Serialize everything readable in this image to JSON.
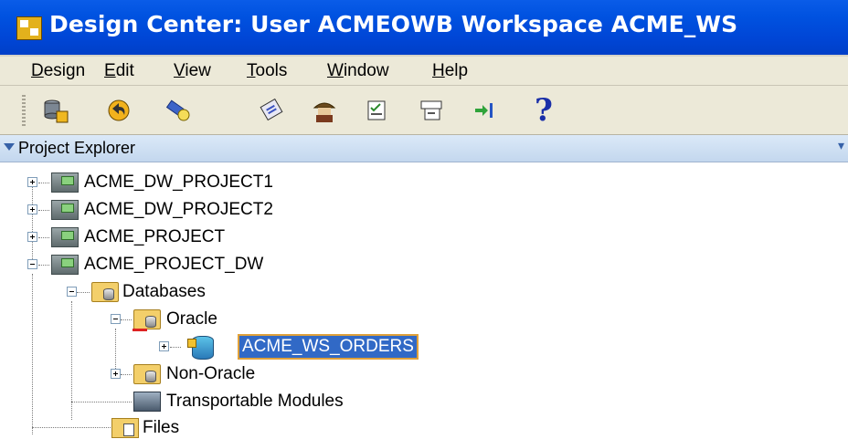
{
  "window": {
    "title": "Design Center: User ACMEOWB   Workspace ACME_WS"
  },
  "menu": [
    {
      "label": "Design",
      "mnemonic": "D"
    },
    {
      "label": "Edit",
      "mnemonic": "E"
    },
    {
      "label": "View",
      "mnemonic": "V"
    },
    {
      "label": "Tools",
      "mnemonic": "T"
    },
    {
      "label": "Window",
      "mnemonic": "W"
    },
    {
      "label": "Help",
      "mnemonic": "H"
    }
  ],
  "toolbar": {
    "icons": [
      "database-save-icon",
      "undo-icon",
      "flashlight-search-icon",
      "validate-icon",
      "deploy-agent-icon",
      "object-editor-icon",
      "properties-icon",
      "goto-icon",
      "help-icon"
    ],
    "help_glyph": "?"
  },
  "panel": {
    "title": "Project Explorer",
    "menu_glyph": "▾"
  },
  "tree": {
    "nodes": [
      {
        "label": "ACME_DW_PROJECT1",
        "expanded": false
      },
      {
        "label": "ACME_DW_PROJECT2",
        "expanded": false
      },
      {
        "label": "ACME_PROJECT",
        "expanded": false
      },
      {
        "label": "ACME_PROJECT_DW",
        "expanded": true
      },
      {
        "label": "Databases",
        "expanded": true
      },
      {
        "label": "Oracle",
        "expanded": true
      },
      {
        "label": "ACME_WS_ORDERS",
        "expanded": false,
        "selected": true
      },
      {
        "label": "Non-Oracle",
        "expanded": false
      },
      {
        "label": "Transportable Modules"
      },
      {
        "label": "Files"
      }
    ]
  },
  "colors": {
    "titlebar": "#0052e0",
    "selection": "#3169c6",
    "selection_outline": "#e0a13a",
    "chrome": "#ece9d8"
  }
}
